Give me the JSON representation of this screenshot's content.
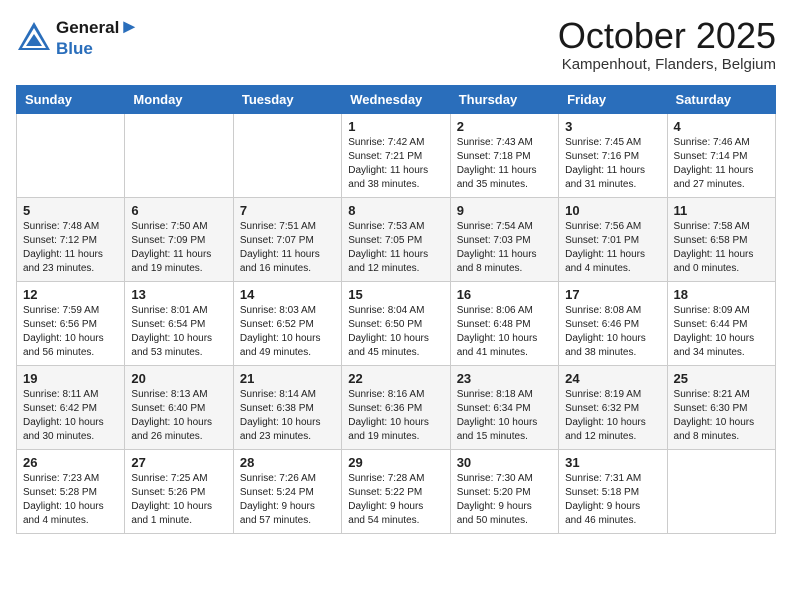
{
  "header": {
    "logo_line1": "General",
    "logo_line2": "Blue",
    "month": "October 2025",
    "location": "Kampenhout, Flanders, Belgium"
  },
  "weekdays": [
    "Sunday",
    "Monday",
    "Tuesday",
    "Wednesday",
    "Thursday",
    "Friday",
    "Saturday"
  ],
  "weeks": [
    [
      {
        "day": "",
        "info": ""
      },
      {
        "day": "",
        "info": ""
      },
      {
        "day": "",
        "info": ""
      },
      {
        "day": "1",
        "info": "Sunrise: 7:42 AM\nSunset: 7:21 PM\nDaylight: 11 hours\nand 38 minutes."
      },
      {
        "day": "2",
        "info": "Sunrise: 7:43 AM\nSunset: 7:18 PM\nDaylight: 11 hours\nand 35 minutes."
      },
      {
        "day": "3",
        "info": "Sunrise: 7:45 AM\nSunset: 7:16 PM\nDaylight: 11 hours\nand 31 minutes."
      },
      {
        "day": "4",
        "info": "Sunrise: 7:46 AM\nSunset: 7:14 PM\nDaylight: 11 hours\nand 27 minutes."
      }
    ],
    [
      {
        "day": "5",
        "info": "Sunrise: 7:48 AM\nSunset: 7:12 PM\nDaylight: 11 hours\nand 23 minutes."
      },
      {
        "day": "6",
        "info": "Sunrise: 7:50 AM\nSunset: 7:09 PM\nDaylight: 11 hours\nand 19 minutes."
      },
      {
        "day": "7",
        "info": "Sunrise: 7:51 AM\nSunset: 7:07 PM\nDaylight: 11 hours\nand 16 minutes."
      },
      {
        "day": "8",
        "info": "Sunrise: 7:53 AM\nSunset: 7:05 PM\nDaylight: 11 hours\nand 12 minutes."
      },
      {
        "day": "9",
        "info": "Sunrise: 7:54 AM\nSunset: 7:03 PM\nDaylight: 11 hours\nand 8 minutes."
      },
      {
        "day": "10",
        "info": "Sunrise: 7:56 AM\nSunset: 7:01 PM\nDaylight: 11 hours\nand 4 minutes."
      },
      {
        "day": "11",
        "info": "Sunrise: 7:58 AM\nSunset: 6:58 PM\nDaylight: 11 hours\nand 0 minutes."
      }
    ],
    [
      {
        "day": "12",
        "info": "Sunrise: 7:59 AM\nSunset: 6:56 PM\nDaylight: 10 hours\nand 56 minutes."
      },
      {
        "day": "13",
        "info": "Sunrise: 8:01 AM\nSunset: 6:54 PM\nDaylight: 10 hours\nand 53 minutes."
      },
      {
        "day": "14",
        "info": "Sunrise: 8:03 AM\nSunset: 6:52 PM\nDaylight: 10 hours\nand 49 minutes."
      },
      {
        "day": "15",
        "info": "Sunrise: 8:04 AM\nSunset: 6:50 PM\nDaylight: 10 hours\nand 45 minutes."
      },
      {
        "day": "16",
        "info": "Sunrise: 8:06 AM\nSunset: 6:48 PM\nDaylight: 10 hours\nand 41 minutes."
      },
      {
        "day": "17",
        "info": "Sunrise: 8:08 AM\nSunset: 6:46 PM\nDaylight: 10 hours\nand 38 minutes."
      },
      {
        "day": "18",
        "info": "Sunrise: 8:09 AM\nSunset: 6:44 PM\nDaylight: 10 hours\nand 34 minutes."
      }
    ],
    [
      {
        "day": "19",
        "info": "Sunrise: 8:11 AM\nSunset: 6:42 PM\nDaylight: 10 hours\nand 30 minutes."
      },
      {
        "day": "20",
        "info": "Sunrise: 8:13 AM\nSunset: 6:40 PM\nDaylight: 10 hours\nand 26 minutes."
      },
      {
        "day": "21",
        "info": "Sunrise: 8:14 AM\nSunset: 6:38 PM\nDaylight: 10 hours\nand 23 minutes."
      },
      {
        "day": "22",
        "info": "Sunrise: 8:16 AM\nSunset: 6:36 PM\nDaylight: 10 hours\nand 19 minutes."
      },
      {
        "day": "23",
        "info": "Sunrise: 8:18 AM\nSunset: 6:34 PM\nDaylight: 10 hours\nand 15 minutes."
      },
      {
        "day": "24",
        "info": "Sunrise: 8:19 AM\nSunset: 6:32 PM\nDaylight: 10 hours\nand 12 minutes."
      },
      {
        "day": "25",
        "info": "Sunrise: 8:21 AM\nSunset: 6:30 PM\nDaylight: 10 hours\nand 8 minutes."
      }
    ],
    [
      {
        "day": "26",
        "info": "Sunrise: 7:23 AM\nSunset: 5:28 PM\nDaylight: 10 hours\nand 4 minutes."
      },
      {
        "day": "27",
        "info": "Sunrise: 7:25 AM\nSunset: 5:26 PM\nDaylight: 10 hours\nand 1 minute."
      },
      {
        "day": "28",
        "info": "Sunrise: 7:26 AM\nSunset: 5:24 PM\nDaylight: 9 hours\nand 57 minutes."
      },
      {
        "day": "29",
        "info": "Sunrise: 7:28 AM\nSunset: 5:22 PM\nDaylight: 9 hours\nand 54 minutes."
      },
      {
        "day": "30",
        "info": "Sunrise: 7:30 AM\nSunset: 5:20 PM\nDaylight: 9 hours\nand 50 minutes."
      },
      {
        "day": "31",
        "info": "Sunrise: 7:31 AM\nSunset: 5:18 PM\nDaylight: 9 hours\nand 46 minutes."
      },
      {
        "day": "",
        "info": ""
      }
    ]
  ]
}
